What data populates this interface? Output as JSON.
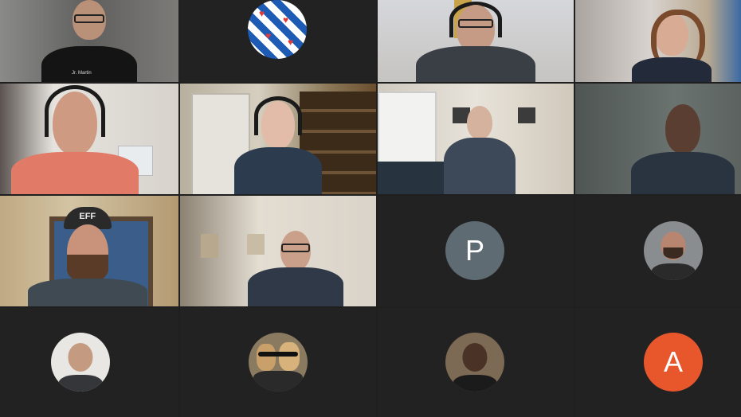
{
  "meeting": {
    "participants": [
      {
        "id": "p1",
        "type": "video",
        "shirt_text": "Jr. Martin"
      },
      {
        "id": "p2",
        "type": "flag-avatar"
      },
      {
        "id": "p3",
        "type": "video"
      },
      {
        "id": "p4",
        "type": "video"
      },
      {
        "id": "p5",
        "type": "video"
      },
      {
        "id": "p6",
        "type": "video"
      },
      {
        "id": "p7",
        "type": "video"
      },
      {
        "id": "p8",
        "type": "video"
      },
      {
        "id": "p9",
        "type": "video",
        "cap_text": "EFF"
      },
      {
        "id": "p10",
        "type": "video"
      },
      {
        "id": "p11",
        "type": "letter-avatar",
        "initial": "P",
        "color": "#5f6b73"
      },
      {
        "id": "p12",
        "type": "photo-avatar"
      },
      {
        "id": "p13",
        "type": "photo-avatar"
      },
      {
        "id": "p14",
        "type": "photo-avatar",
        "icon": "dogs-photo-icon"
      },
      {
        "id": "p15",
        "type": "photo-avatar"
      },
      {
        "id": "p16",
        "type": "letter-avatar",
        "initial": "A",
        "color": "#e8572c"
      }
    ]
  },
  "colors": {
    "background": "#1f1f1f",
    "active_speaker": "#2d8cff"
  }
}
